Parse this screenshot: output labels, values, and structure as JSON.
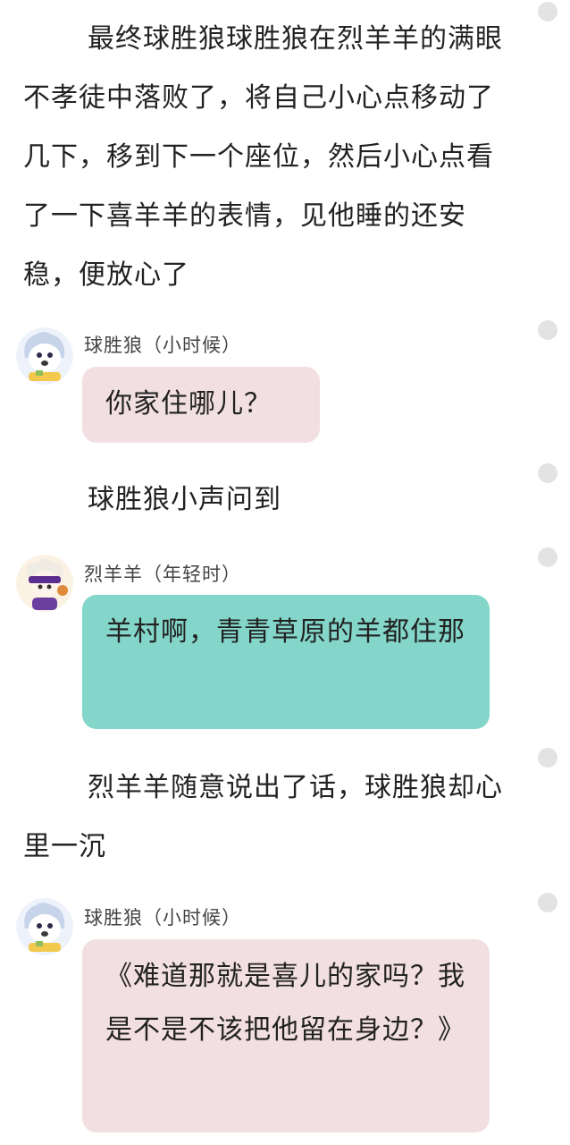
{
  "colors": {
    "pink_bubble": "#f2dfe1",
    "teal_bubble": "#83d6c9",
    "side_dot": "#e3e3e3"
  },
  "narration_1": "最终球胜狼球胜狼在烈羊羊的满眼不孝徒中落败了，将自己小心点移动了几下，移到下一个座位，然后小心点看了一下喜羊羊的表情，见他睡的还安稳，便放心了",
  "message_1": {
    "sender": "球胜狼（小时候）",
    "avatar": "wolf-avatar",
    "text": "你家住哪儿？"
  },
  "narration_2": "球胜狼小声问到",
  "message_2": {
    "sender": "烈羊羊（年轻时）",
    "avatar": "sheep-avatar",
    "text": "羊村啊，青青草原的羊都住那"
  },
  "narration_3": "烈羊羊随意说出了话，球胜狼却心里一沉",
  "message_3": {
    "sender": "球胜狼（小时候）",
    "avatar": "wolf-avatar",
    "text": "《难道那就是喜儿的家吗？我是不是不该把他留在身边？》"
  }
}
